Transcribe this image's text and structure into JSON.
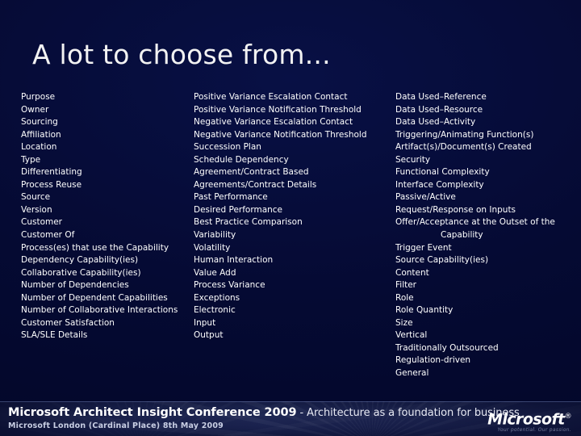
{
  "slide": {
    "title": "A lot to choose from...",
    "background_color": "#050a33",
    "text_color": "#ffffff"
  },
  "columns": [
    {
      "name": "column-1",
      "items": [
        "Purpose",
        "Owner",
        "Sourcing",
        "Affiliation",
        "Location",
        "Type",
        "Differentiating",
        "Process Reuse",
        "Source",
        "Version",
        "Customer",
        "Customer Of",
        "Process(es) that use the Capability",
        "Dependency Capability(ies)",
        "Collaborative Capability(ies)",
        "Number of Dependencies",
        "Number of Dependent Capabilities",
        "Number of Collaborative Interactions",
        "Customer Satisfaction",
        "SLA/SLE Details"
      ]
    },
    {
      "name": "column-2",
      "items": [
        "Positive Variance Escalation Contact",
        "Positive Variance Notification Threshold",
        "Negative Variance Escalation Contact",
        "Negative Variance Notification Threshold",
        "Succession Plan",
        "Schedule Dependency",
        "Agreement/Contract Based",
        "Agreements/Contract Details",
        "Past Performance",
        "Desired Performance",
        "Best Practice Comparison",
        "Variability",
        "Volatility",
        "Human Interaction",
        "Value Add",
        "Process Variance",
        "Exceptions",
        "Electronic",
        "Input",
        "Output"
      ]
    },
    {
      "name": "column-3",
      "items": [
        "Data Used–Reference",
        "Data Used–Resource",
        "Data Used–Activity",
        "Triggering/Animating Function(s)",
        "Artifact(s)/Document(s) Created",
        "Security",
        "Functional Complexity",
        "Interface Complexity",
        "Passive/Active",
        "Request/Response on Inputs",
        "Offer/Acceptance at the Outset of the",
        "Capability",
        "Trigger Event",
        "Source Capability(ies)",
        "Content",
        "Filter",
        "Role",
        "Role Quantity",
        "Size",
        "Vertical",
        "Traditionally Outsourced",
        "Regulation-driven",
        "General"
      ]
    }
  ],
  "footer": {
    "event_title": "Microsoft Architect Insight Conference 2009",
    "separator": " - ",
    "tagline": "Architecture as a foundation for business",
    "venue": "Microsoft London (Cardinal Place) 8th May 2009",
    "logo_word": "Microsoft",
    "logo_registered": "®",
    "logo_tagline": "Your potential. Our passion.",
    "band_color": "#1b2350"
  }
}
